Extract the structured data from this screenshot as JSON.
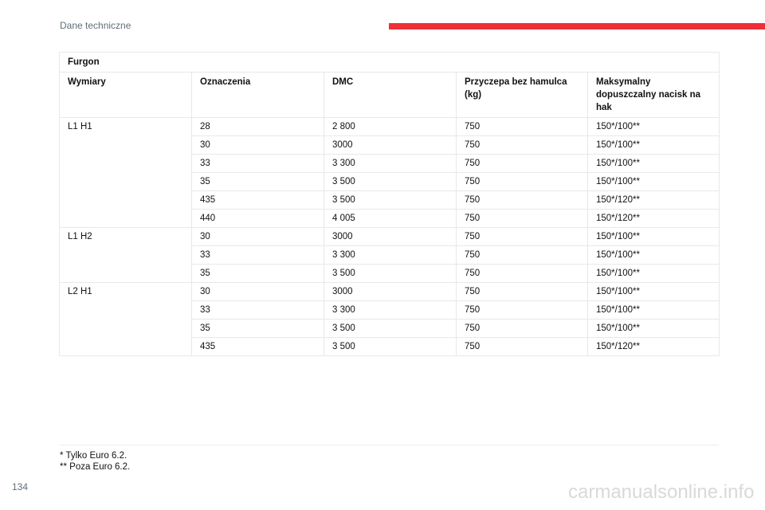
{
  "header": {
    "title": "Dane techniczne",
    "accent_color": "#ee2f36"
  },
  "table": {
    "title": "Furgon",
    "columns": [
      "Wymiary",
      "Oznaczenia",
      "DMC",
      "Przyczepa bez hamulca (kg)",
      "Maksymalny dopuszczalny nacisk na hak"
    ],
    "groups": [
      {
        "dimension": "L1 H1",
        "rows": [
          [
            "28",
            "2 800",
            "750",
            "150*/100**"
          ],
          [
            "30",
            "3000",
            "750",
            "150*/100**"
          ],
          [
            "33",
            "3 300",
            "750",
            "150*/100**"
          ],
          [
            "35",
            "3 500",
            "750",
            "150*/100**"
          ],
          [
            "435",
            "3 500",
            "750",
            "150*/120**"
          ],
          [
            "440",
            "4 005",
            "750",
            "150*/120**"
          ]
        ]
      },
      {
        "dimension": "L1 H2",
        "rows": [
          [
            "30",
            "3000",
            "750",
            "150*/100**"
          ],
          [
            "33",
            "3 300",
            "750",
            "150*/100**"
          ],
          [
            "35",
            "3 500",
            "750",
            "150*/100**"
          ]
        ]
      },
      {
        "dimension": "L2 H1",
        "rows": [
          [
            "30",
            "3000",
            "750",
            "150*/100**"
          ],
          [
            "33",
            "3 300",
            "750",
            "150*/100**"
          ],
          [
            "35",
            "3 500",
            "750",
            "150*/100**"
          ],
          [
            "435",
            "3 500",
            "750",
            "150*/120**"
          ]
        ]
      }
    ]
  },
  "footnotes": [
    "* Tylko Euro 6.2.",
    "** Poza Euro 6.2."
  ],
  "page_number": "134",
  "watermark": "carmanualsonline.info"
}
